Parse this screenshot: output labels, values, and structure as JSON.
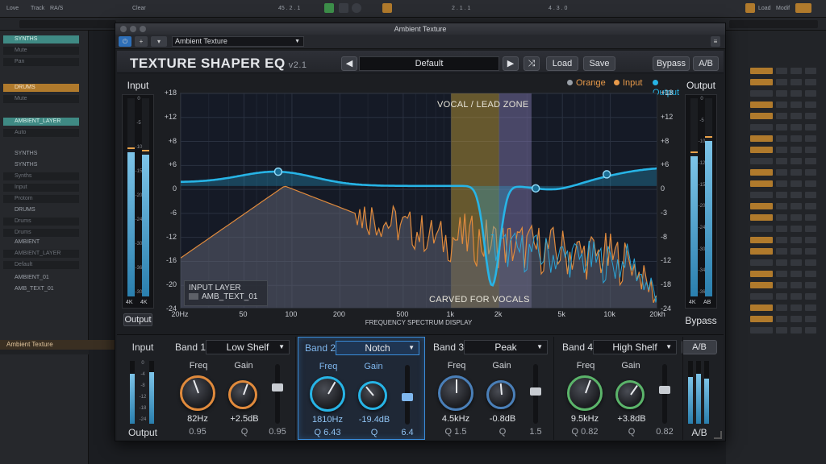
{
  "daw": {
    "menu": [
      "Love",
      "Track",
      "RA/S",
      "Clear",
      "Load",
      "Modif"
    ],
    "tracks": [
      {
        "label": "SYNTHS",
        "kind": "hdr"
      },
      {
        "label": "Mute",
        "kind": "sub"
      },
      {
        "label": "Pan",
        "kind": "sub"
      },
      {
        "label": "DRUMS",
        "kind": "hdr-orange"
      },
      {
        "label": "Mute",
        "kind": "sub"
      },
      {
        "label": "AMBIENT_LAYER",
        "kind": "hdr"
      },
      {
        "label": "Auto",
        "kind": "sub"
      },
      {
        "label": "SYNTHS",
        "kind": "plain"
      },
      {
        "label": "SYNTHS",
        "kind": "plain"
      },
      {
        "label": "Synths",
        "kind": "sub"
      },
      {
        "label": "Input",
        "kind": "sub"
      },
      {
        "label": "Protom",
        "kind": "sub"
      },
      {
        "label": "DRUMS",
        "kind": "plain"
      },
      {
        "label": "Drums",
        "kind": "sub"
      },
      {
        "label": "Drums",
        "kind": "sub"
      },
      {
        "label": "AMBIENT",
        "kind": "plain"
      },
      {
        "label": "AMBIENT_LAYER",
        "kind": "sub"
      },
      {
        "label": "Default",
        "kind": "sub"
      },
      {
        "label": "AMBIENT_01",
        "kind": "plain"
      },
      {
        "label": "AMB_TEXT_01",
        "kind": "plain"
      }
    ],
    "bottom_track": "Ambient Texture",
    "transport": [
      "45 . 2 . 1",
      "2 . 1 . 1",
      "4 . 3 . 0"
    ]
  },
  "window": {
    "title": "Ambient Texture",
    "preset_select": "Ambient Texture"
  },
  "plugin": {
    "name": "TEXTURE SHAPER EQ",
    "version": "v2.1",
    "preset": "Default",
    "load_label": "Load",
    "save_label": "Save",
    "bypass_label": "Bypass",
    "ab_label": "A/B",
    "prev_glyph": "◀",
    "next_glyph": "▶",
    "shuffle_glyph": "⤨"
  },
  "meters": {
    "input": {
      "label": "Input",
      "button": "Output",
      "ch": [
        "4K",
        "4K"
      ],
      "scale": [
        "0",
        "-5",
        "-10",
        "-15",
        "-20",
        "-24",
        "-30",
        "-36",
        "-30"
      ],
      "levels": [
        0.72,
        0.71
      ]
    },
    "output": {
      "label": "Output",
      "button": "Bypass",
      "ch": [
        "4K",
        "AB"
      ],
      "scale": [
        "0",
        "-5",
        "-10",
        "-12",
        "-15",
        "-20",
        "-24",
        "-30",
        "-34",
        "-36"
      ],
      "levels": [
        0.7,
        0.78
      ]
    }
  },
  "graph": {
    "legend": [
      {
        "label": "Orange",
        "color": "#9aa0a8",
        "text_color": "#e89a4a"
      },
      {
        "label": "Input",
        "color": "#e89a4a",
        "text_color": "#e89a4a"
      },
      {
        "label": "Output",
        "color": "#27b4e6",
        "text_color": "#27b4e6"
      }
    ],
    "y_left": [
      "+18",
      "+12",
      "+8",
      "+6",
      "0",
      "-6",
      "-12",
      "-16",
      "-20",
      "-24"
    ],
    "y_right": [
      "+18",
      "+12",
      "+8",
      "+6",
      "0",
      "-3",
      "-8",
      "-12",
      "-18",
      "-24"
    ],
    "x_ticks": [
      {
        "label": "20Hz",
        "f": 20
      },
      {
        "label": "50",
        "f": 50
      },
      {
        "label": "100",
        "f": 100
      },
      {
        "label": "200",
        "f": 200
      },
      {
        "label": "500",
        "f": 500
      },
      {
        "label": "1k",
        "f": 1000
      },
      {
        "label": "2k",
        "f": 2000
      },
      {
        "label": "5k",
        "f": 5000
      },
      {
        "label": "10k",
        "f": 10000
      },
      {
        "label": "20kh",
        "f": 20000
      }
    ],
    "x_title": "FREQUENCY SPECTRUM DISPLAY",
    "zone_label": "VOCAL / LEAD ZONE",
    "zone_range_hz": [
      1000,
      3200
    ],
    "carved_label": "CARVED FOR VOCALS",
    "input_layer_title": "INPUT LAYER",
    "input_layer_name": "AMB_TEXT_01",
    "colors": {
      "output": "#27b4e6",
      "input": "#e08a3c",
      "zone": "#c9a33a",
      "zone_purple": "#8a7fb8"
    }
  },
  "bands": [
    {
      "name": "Band 1",
      "type": "Low Shelf",
      "freq_label": "Freq",
      "gain_label": "Gain",
      "freq": "82Hz",
      "gain": "+2.5dB",
      "q_value": "0.95",
      "q_label": "Q",
      "slider_value": "0.95",
      "accent": "#e08a3c",
      "freq_angle": -20,
      "gain_angle": 20,
      "thumb": 0.38
    },
    {
      "name": "Band 2",
      "type": "Notch",
      "freq_label": "Freq",
      "gain_label": "Gain",
      "freq": "1810Hz",
      "gain": "-19.4dB",
      "q_value": "Q 6.43",
      "q_label": "Q",
      "slider_value": "6.4",
      "accent": "#27b4e6",
      "freq_angle": 30,
      "gain_angle": -40,
      "thumb": 0.55,
      "active": true
    },
    {
      "name": "Band 3",
      "type": "Peak",
      "freq_label": "Freq",
      "gain_label": "Gain",
      "freq": "4.5kHz",
      "gain": "-0.8dB",
      "q_value": "Q 1.5",
      "q_label": "Q",
      "slider_value": "1.5",
      "accent": "#4a7fb8",
      "freq_angle": 0,
      "gain_angle": -5,
      "thumb": 0.45
    },
    {
      "name": "Band 4",
      "type": "High Shelf",
      "freq_label": "Freq",
      "gain_label": "Gain",
      "freq": "9.5kHz",
      "gain": "+3.8dB",
      "q_value": "Q 0.82",
      "q_label": "Q",
      "slider_value": "0.82",
      "accent": "#5bb46a",
      "freq_angle": 20,
      "gain_angle": 35,
      "thumb": 0.42
    }
  ],
  "io_left": {
    "top": "Input",
    "bottom": "Output",
    "scale": [
      "0",
      "-4",
      "-8",
      "-12",
      "-18",
      "-24"
    ]
  },
  "io_right": {
    "top": "A/B",
    "bottom": "A/B"
  }
}
